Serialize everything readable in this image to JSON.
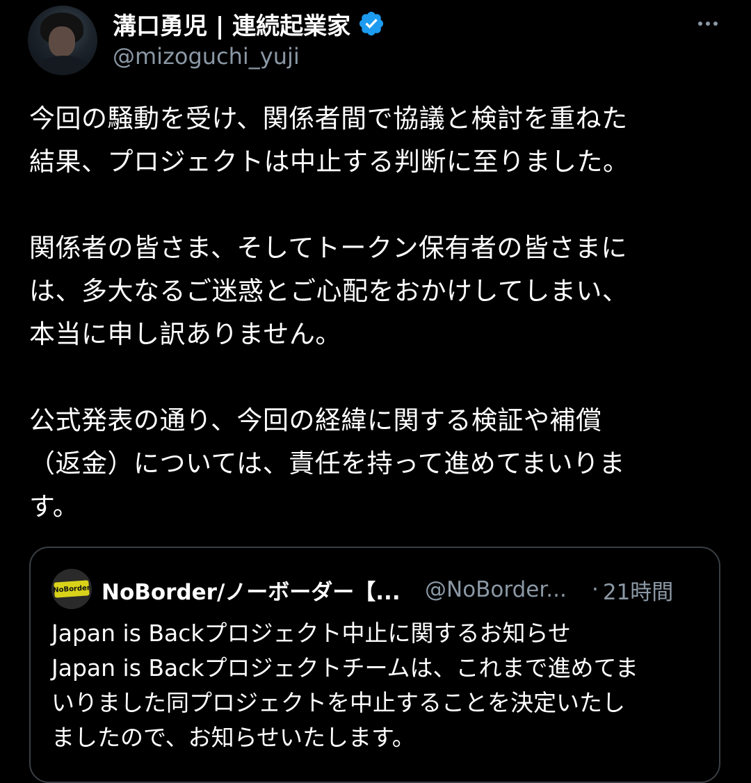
{
  "tweet": {
    "author": {
      "display_name": "溝口勇児 | 連続起業家",
      "handle": "@mizoguchi_yuji",
      "verified_color": "#1d9bf0"
    },
    "body_lines": [
      "今回の騒動を受け、関係者間で協議と検討を重ねた",
      "結果、プロジェクトは中止する判断に至りました。",
      "",
      "関係者の皆さま、そしてトークン保有者の皆さまに",
      "は、多大なるご迷惑とご心配をおかけしてしまい、",
      "本当に申し訳ありません。",
      "",
      "公式発表の通り、今回の経緯に関する検証や補償",
      "（返金）については、責任を持って進めてまいりま",
      "す。"
    ],
    "quote": {
      "avatar_logo_text": "NoBorder",
      "display_name": "NoBorder/ノーボーダー【...",
      "handle": "@NoBorder...",
      "separator": "·",
      "time": "21時間",
      "text_lines": [
        "Japan is Backプロジェクト中止に関するお知らせ",
        "Japan is Backプロジェクトチームは、これまで進めてま",
        "いりました同プロジェクトを中止することを決定いたし",
        "ましたので、お知らせいたします。"
      ]
    }
  }
}
